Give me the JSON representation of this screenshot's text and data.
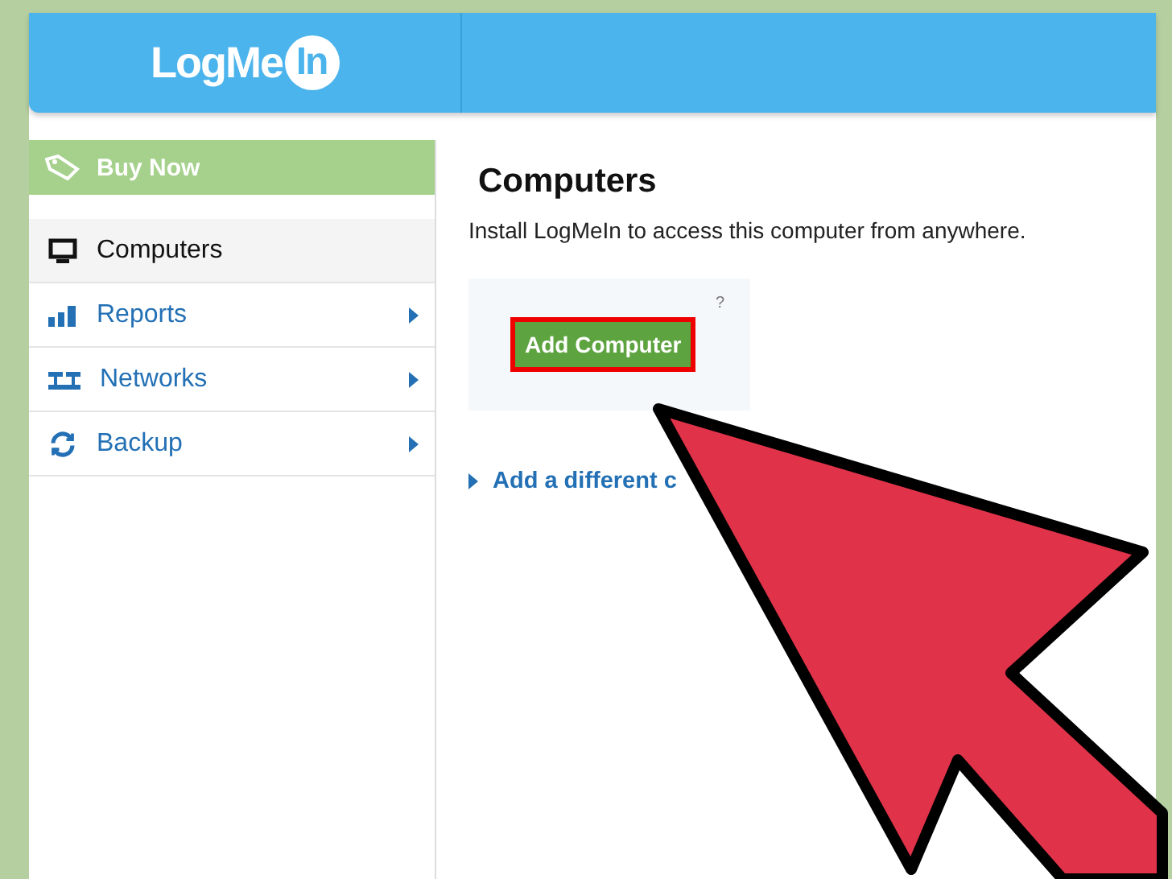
{
  "header": {
    "logo": {
      "main": "LogMe",
      "badge": "In"
    }
  },
  "sidebar": {
    "buy_now": "Buy Now",
    "items": [
      {
        "label": "Computers",
        "selected": true,
        "has_submenu": false
      },
      {
        "label": "Reports",
        "selected": false,
        "has_submenu": true
      },
      {
        "label": "Networks",
        "selected": false,
        "has_submenu": true
      },
      {
        "label": "Backup",
        "selected": false,
        "has_submenu": true
      }
    ]
  },
  "main": {
    "title": "Computers",
    "description": "Install LogMeIn to access this computer from anywhere.",
    "add_button": {
      "label": "Add Computer",
      "highlighted": true
    },
    "help": "?",
    "link": "Add a different c"
  }
}
